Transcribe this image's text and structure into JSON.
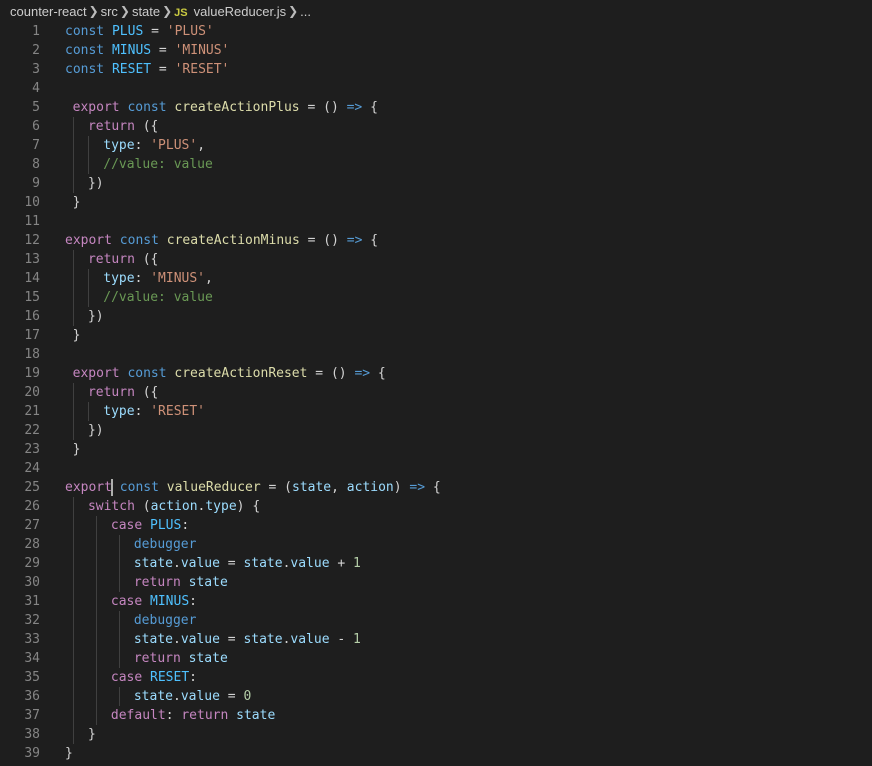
{
  "breadcrumb": {
    "items": [
      "counter-react",
      "src",
      "state"
    ],
    "file_badge": "JS",
    "file_name": "valueReducer.js",
    "more": "..."
  },
  "colors": {
    "keyword": "#569cd6",
    "control": "#c586c0",
    "function": "#dcdcaa",
    "constant": "#4fc1ff",
    "variable": "#9cdcfe",
    "string": "#ce9178",
    "comment": "#6a9955",
    "number": "#b5cea8"
  },
  "lines": [
    {
      "n": "1",
      "indent": 0,
      "guides": [],
      "t": [
        [
          "kw",
          "const"
        ],
        [
          "p",
          " "
        ],
        [
          "const",
          "PLUS"
        ],
        [
          "p",
          " = "
        ],
        [
          "str",
          "'PLUS'"
        ]
      ]
    },
    {
      "n": "2",
      "indent": 0,
      "guides": [],
      "t": [
        [
          "kw",
          "const"
        ],
        [
          "p",
          " "
        ],
        [
          "const",
          "MINUS"
        ],
        [
          "p",
          " = "
        ],
        [
          "str",
          "'MINUS'"
        ]
      ]
    },
    {
      "n": "3",
      "indent": 0,
      "guides": [],
      "t": [
        [
          "kw",
          "const"
        ],
        [
          "p",
          " "
        ],
        [
          "const",
          "RESET"
        ],
        [
          "p",
          " = "
        ],
        [
          "str",
          "'RESET'"
        ]
      ]
    },
    {
      "n": "4",
      "indent": 0,
      "guides": [],
      "t": []
    },
    {
      "n": "5",
      "indent": 1,
      "guides": [],
      "t": [
        [
          "ctl",
          "export"
        ],
        [
          "p",
          " "
        ],
        [
          "kw",
          "const"
        ],
        [
          "p",
          " "
        ],
        [
          "fn",
          "createActionPlus"
        ],
        [
          "p",
          " = () "
        ],
        [
          "kw",
          "=>"
        ],
        [
          "p",
          " {"
        ]
      ]
    },
    {
      "n": "6",
      "indent": 3,
      "guides": [
        1
      ],
      "t": [
        [
          "ctl",
          "return"
        ],
        [
          "p",
          " ({"
        ]
      ]
    },
    {
      "n": "7",
      "indent": 5,
      "guides": [
        1,
        3
      ],
      "t": [
        [
          "var",
          "type"
        ],
        [
          "p",
          ": "
        ],
        [
          "str",
          "'PLUS'"
        ],
        [
          "p",
          ","
        ]
      ]
    },
    {
      "n": "8",
      "indent": 5,
      "guides": [
        1,
        3
      ],
      "t": [
        [
          "com",
          "//value: value"
        ]
      ]
    },
    {
      "n": "9",
      "indent": 3,
      "guides": [
        1
      ],
      "t": [
        [
          "p",
          "})"
        ]
      ]
    },
    {
      "n": "10",
      "indent": 1,
      "guides": [],
      "t": [
        [
          "p",
          "}"
        ]
      ]
    },
    {
      "n": "11",
      "indent": 0,
      "guides": [],
      "t": []
    },
    {
      "n": "12",
      "indent": 0,
      "guides": [],
      "t": [
        [
          "ctl",
          "export"
        ],
        [
          "p",
          " "
        ],
        [
          "kw",
          "const"
        ],
        [
          "p",
          " "
        ],
        [
          "fn",
          "createActionMinus"
        ],
        [
          "p",
          " = () "
        ],
        [
          "kw",
          "=>"
        ],
        [
          "p",
          " {"
        ]
      ]
    },
    {
      "n": "13",
      "indent": 3,
      "guides": [
        1
      ],
      "t": [
        [
          "ctl",
          "return"
        ],
        [
          "p",
          " ({"
        ]
      ]
    },
    {
      "n": "14",
      "indent": 5,
      "guides": [
        1,
        3
      ],
      "t": [
        [
          "var",
          "type"
        ],
        [
          "p",
          ": "
        ],
        [
          "str",
          "'MINUS'"
        ],
        [
          "p",
          ","
        ]
      ]
    },
    {
      "n": "15",
      "indent": 5,
      "guides": [
        1,
        3
      ],
      "t": [
        [
          "com",
          "//value: value"
        ]
      ]
    },
    {
      "n": "16",
      "indent": 3,
      "guides": [
        1
      ],
      "t": [
        [
          "p",
          "})"
        ]
      ]
    },
    {
      "n": "17",
      "indent": 1,
      "guides": [],
      "t": [
        [
          "p",
          "}"
        ]
      ]
    },
    {
      "n": "18",
      "indent": 0,
      "guides": [],
      "t": []
    },
    {
      "n": "19",
      "indent": 1,
      "guides": [],
      "t": [
        [
          "ctl",
          "export"
        ],
        [
          "p",
          " "
        ],
        [
          "kw",
          "const"
        ],
        [
          "p",
          " "
        ],
        [
          "fn",
          "createActionReset"
        ],
        [
          "p",
          " = () "
        ],
        [
          "kw",
          "=>"
        ],
        [
          "p",
          " {"
        ]
      ]
    },
    {
      "n": "20",
      "indent": 3,
      "guides": [
        1
      ],
      "t": [
        [
          "ctl",
          "return"
        ],
        [
          "p",
          " ({"
        ]
      ]
    },
    {
      "n": "21",
      "indent": 5,
      "guides": [
        1,
        3
      ],
      "t": [
        [
          "var",
          "type"
        ],
        [
          "p",
          ": "
        ],
        [
          "str",
          "'RESET'"
        ]
      ]
    },
    {
      "n": "22",
      "indent": 3,
      "guides": [
        1
      ],
      "t": [
        [
          "p",
          "})"
        ]
      ]
    },
    {
      "n": "23",
      "indent": 1,
      "guides": [],
      "t": [
        [
          "p",
          "}"
        ]
      ]
    },
    {
      "n": "24",
      "indent": 0,
      "guides": [],
      "t": []
    },
    {
      "n": "25",
      "indent": 0,
      "guides": [],
      "cursor": 6,
      "t": [
        [
          "ctl",
          "export"
        ],
        [
          "p",
          " "
        ],
        [
          "kw",
          "const"
        ],
        [
          "p",
          " "
        ],
        [
          "fn",
          "valueReducer"
        ],
        [
          "p",
          " = ("
        ],
        [
          "var",
          "state"
        ],
        [
          "p",
          ", "
        ],
        [
          "var",
          "action"
        ],
        [
          "p",
          ") "
        ],
        [
          "kw",
          "=>"
        ],
        [
          "p",
          " {"
        ]
      ]
    },
    {
      "n": "26",
      "indent": 3,
      "guides": [
        1
      ],
      "t": [
        [
          "ctl",
          "switch"
        ],
        [
          "p",
          " ("
        ],
        [
          "var",
          "action"
        ],
        [
          "p",
          "."
        ],
        [
          "var",
          "type"
        ],
        [
          "p",
          ") {"
        ]
      ]
    },
    {
      "n": "27",
      "indent": 6,
      "guides": [
        1,
        4
      ],
      "t": [
        [
          "ctl",
          "case"
        ],
        [
          "p",
          " "
        ],
        [
          "const",
          "PLUS"
        ],
        [
          "p",
          ":"
        ]
      ]
    },
    {
      "n": "28",
      "indent": 9,
      "guides": [
        1,
        4,
        7
      ],
      "t": [
        [
          "kw",
          "debugger"
        ]
      ]
    },
    {
      "n": "29",
      "indent": 9,
      "guides": [
        1,
        4,
        7
      ],
      "t": [
        [
          "var",
          "state"
        ],
        [
          "p",
          "."
        ],
        [
          "var",
          "value"
        ],
        [
          "p",
          " = "
        ],
        [
          "var",
          "state"
        ],
        [
          "p",
          "."
        ],
        [
          "var",
          "value"
        ],
        [
          "p",
          " + "
        ],
        [
          "num",
          "1"
        ]
      ]
    },
    {
      "n": "30",
      "indent": 9,
      "guides": [
        1,
        4,
        7
      ],
      "t": [
        [
          "ctl",
          "return"
        ],
        [
          "p",
          " "
        ],
        [
          "var",
          "state"
        ]
      ]
    },
    {
      "n": "31",
      "indent": 6,
      "guides": [
        1,
        4
      ],
      "t": [
        [
          "ctl",
          "case"
        ],
        [
          "p",
          " "
        ],
        [
          "const",
          "MINUS"
        ],
        [
          "p",
          ":"
        ]
      ]
    },
    {
      "n": "32",
      "indent": 9,
      "guides": [
        1,
        4,
        7
      ],
      "t": [
        [
          "kw",
          "debugger"
        ]
      ]
    },
    {
      "n": "33",
      "indent": 9,
      "guides": [
        1,
        4,
        7
      ],
      "t": [
        [
          "var",
          "state"
        ],
        [
          "p",
          "."
        ],
        [
          "var",
          "value"
        ],
        [
          "p",
          " = "
        ],
        [
          "var",
          "state"
        ],
        [
          "p",
          "."
        ],
        [
          "var",
          "value"
        ],
        [
          "p",
          " - "
        ],
        [
          "num",
          "1"
        ]
      ]
    },
    {
      "n": "34",
      "indent": 9,
      "guides": [
        1,
        4,
        7
      ],
      "t": [
        [
          "ctl",
          "return"
        ],
        [
          "p",
          " "
        ],
        [
          "var",
          "state"
        ]
      ]
    },
    {
      "n": "35",
      "indent": 6,
      "guides": [
        1,
        4
      ],
      "t": [
        [
          "ctl",
          "case"
        ],
        [
          "p",
          " "
        ],
        [
          "const",
          "RESET"
        ],
        [
          "p",
          ":"
        ]
      ]
    },
    {
      "n": "36",
      "indent": 9,
      "guides": [
        1,
        4,
        7
      ],
      "t": [
        [
          "var",
          "state"
        ],
        [
          "p",
          "."
        ],
        [
          "var",
          "value"
        ],
        [
          "p",
          " = "
        ],
        [
          "num",
          "0"
        ]
      ]
    },
    {
      "n": "37",
      "indent": 6,
      "guides": [
        1,
        4
      ],
      "t": [
        [
          "ctl",
          "default"
        ],
        [
          "p",
          ": "
        ],
        [
          "ctl",
          "return"
        ],
        [
          "p",
          " "
        ],
        [
          "var",
          "state"
        ]
      ]
    },
    {
      "n": "38",
      "indent": 3,
      "guides": [
        1
      ],
      "t": [
        [
          "p",
          "}"
        ]
      ]
    },
    {
      "n": "39",
      "indent": 0,
      "guides": [],
      "t": [
        [
          "p",
          "}"
        ]
      ]
    }
  ]
}
